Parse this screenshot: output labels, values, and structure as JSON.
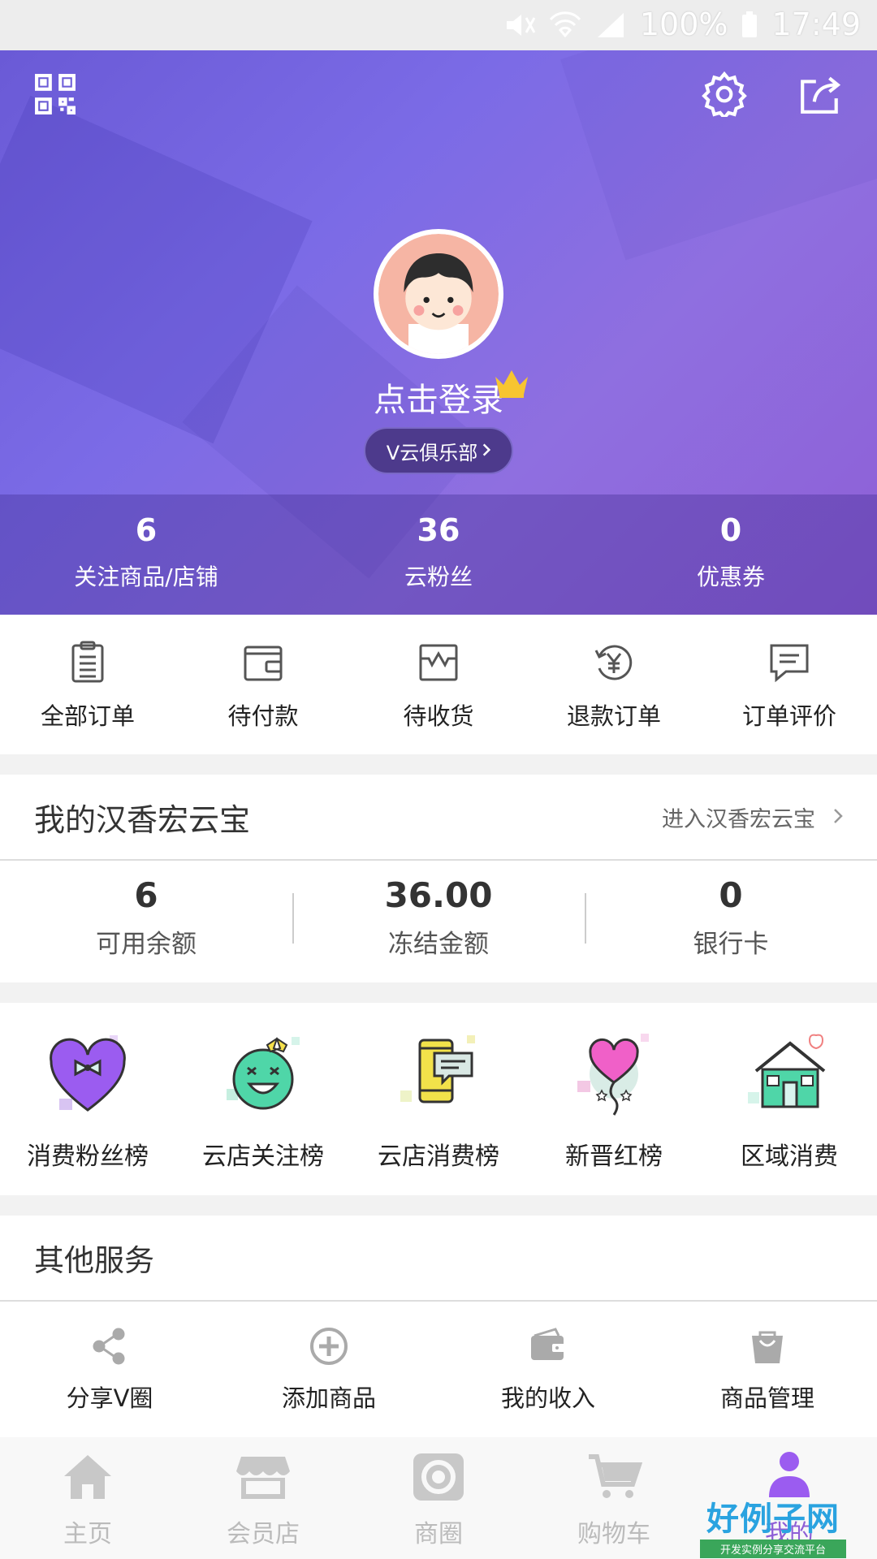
{
  "status_bar": {
    "battery": "100%",
    "time": "17:49"
  },
  "header": {
    "login_text": "点击登录",
    "club_label": "V云俱乐部",
    "stats": [
      {
        "value": "6",
        "label": "关注商品/店铺"
      },
      {
        "value": "36",
        "label": "云粉丝"
      },
      {
        "value": "0",
        "label": "优惠券"
      }
    ]
  },
  "orders": [
    {
      "label": "全部订单",
      "icon": "clipboard-icon"
    },
    {
      "label": "待付款",
      "icon": "wallet-icon"
    },
    {
      "label": "待收货",
      "icon": "package-icon"
    },
    {
      "label": "退款订单",
      "icon": "refund-yen-icon"
    },
    {
      "label": "订单评价",
      "icon": "comment-icon"
    }
  ],
  "wallet": {
    "title": "我的汉香宏云宝",
    "link": "进入汉香宏云宝",
    "items": [
      {
        "value": "6",
        "label": "可用余额"
      },
      {
        "value": "36.00",
        "label": "冻结金额"
      },
      {
        "value": "0",
        "label": "银行卡"
      }
    ]
  },
  "ranks": [
    {
      "label": "消费粉丝榜",
      "icon": "heart-bow-icon",
      "color": "#9b5cf0"
    },
    {
      "label": "云店关注榜",
      "icon": "smiley-bow-icon",
      "color": "#4fd6a8"
    },
    {
      "label": "云店消费榜",
      "icon": "phone-chat-icon",
      "color": "#f2e24a"
    },
    {
      "label": "新晋红榜",
      "icon": "heart-balloon-icon",
      "color": "#f060c8"
    },
    {
      "label": "区域消费",
      "icon": "house-icon",
      "color": "#4fd6a8"
    }
  ],
  "services": {
    "title": "其他服务",
    "items": [
      {
        "label": "分享V圈",
        "icon": "share-icon"
      },
      {
        "label": "添加商品",
        "icon": "add-circle-icon"
      },
      {
        "label": "我的收入",
        "icon": "income-wallet-icon"
      },
      {
        "label": "商品管理",
        "icon": "shopping-bag-icon"
      }
    ]
  },
  "tabbar": [
    {
      "label": "主页",
      "icon": "home-icon"
    },
    {
      "label": "会员店",
      "icon": "store-icon"
    },
    {
      "label": "商圈",
      "icon": "camera-icon"
    },
    {
      "label": "购物车",
      "icon": "cart-icon"
    },
    {
      "label": "我的",
      "icon": "user-icon",
      "active": true
    }
  ],
  "watermark": {
    "title": "好例子网",
    "subtitle": "开发实例分享交流平台"
  },
  "colors": {
    "accent": "#8e5fd6",
    "header_start": "#6a5ad6",
    "header_end": "#8e5fd6"
  }
}
